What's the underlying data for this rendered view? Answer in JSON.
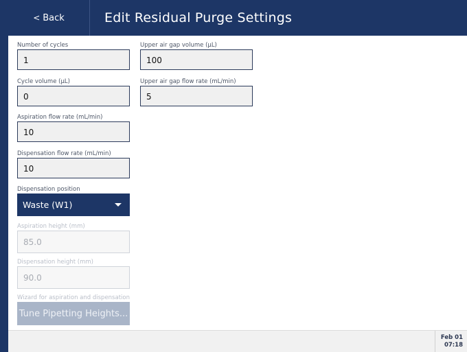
{
  "header": {
    "back_label": "Back",
    "title": "Edit Residual Purge Settings"
  },
  "fields": {
    "number_of_cycles": {
      "label": "Number of cycles",
      "value": "1"
    },
    "cycle_volume": {
      "label": "Cycle volume (µL)",
      "value": "0"
    },
    "aspiration_flow_rate": {
      "label": "Aspiration flow rate (mL/min)",
      "value": "10"
    },
    "dispensation_flow_rate": {
      "label": "Dispensation flow rate (mL/min)",
      "value": "10"
    },
    "dispensation_position": {
      "label": "Dispensation position",
      "value": "Waste (W1)"
    },
    "aspiration_height": {
      "label": "Aspiration height (mm)",
      "value": "85.0"
    },
    "dispensation_height": {
      "label": "Dispensation height (mm)",
      "value": "90.0"
    },
    "upper_air_gap_volume": {
      "label": "Upper air gap volume (µL)",
      "value": "100"
    },
    "upper_air_gap_flow_rate": {
      "label": "Upper air gap flow rate (mL/min)",
      "value": "5"
    }
  },
  "wizard": {
    "label": "Wizard for aspiration and dispensation",
    "button_label": "Tune Pipetting Heights..."
  },
  "footer": {
    "date": "Feb 01",
    "time": "07:18"
  },
  "colors": {
    "primary": "#1d3666",
    "disabled_button": "#a9b5c8"
  }
}
